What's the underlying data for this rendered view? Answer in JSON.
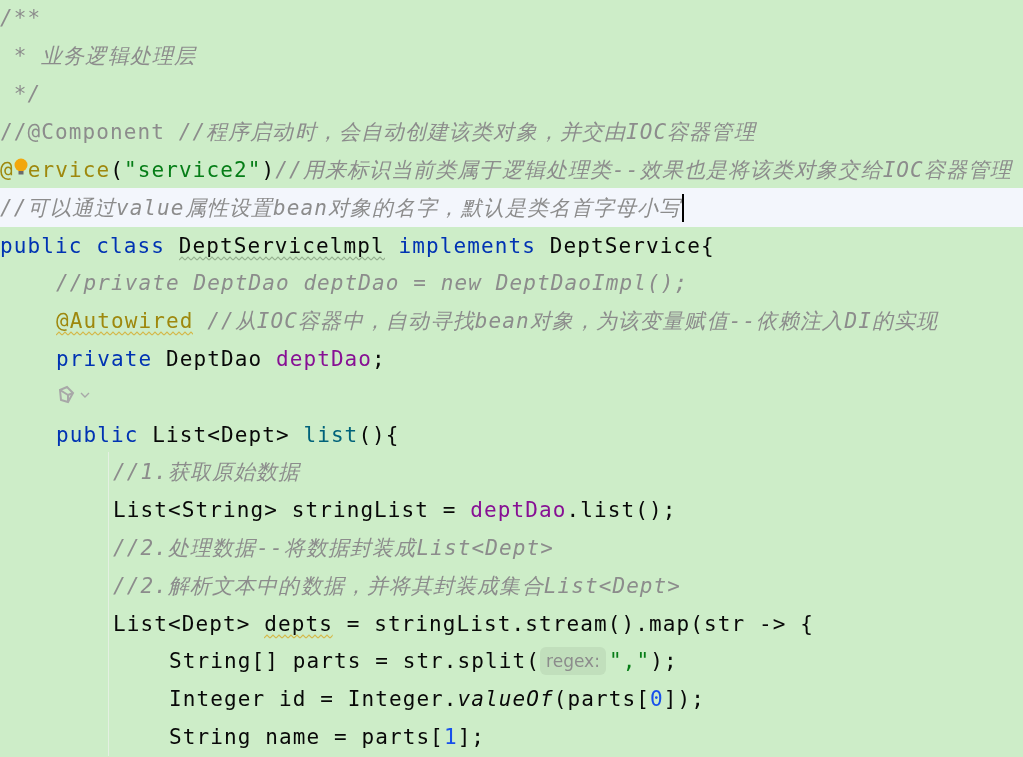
{
  "editor": {
    "lines": [
      {
        "kind": "code",
        "tokens": [
          {
            "text": "/**",
            "kind": "comment"
          }
        ]
      },
      {
        "kind": "code",
        "tokens": [
          {
            "text": " * 业务逻辑处理层",
            "kind": "comment"
          }
        ]
      },
      {
        "kind": "code",
        "tokens": [
          {
            "text": " */",
            "kind": "comment"
          }
        ]
      },
      {
        "kind": "code",
        "tokens": [
          {
            "text": "//@Component ",
            "kind": "commented-code"
          },
          {
            "text": "//程序启动时，会自动创建该类对象，并交由IOC容器管理",
            "kind": "comment"
          }
        ]
      },
      {
        "kind": "code",
        "tokens": [
          {
            "text": "@",
            "kind": "annotation"
          },
          {
            "kind": "bulb"
          },
          {
            "text": "ervice",
            "kind": "annotation"
          },
          {
            "text": "(",
            "kind": "plain"
          },
          {
            "text": "\"service2\"",
            "kind": "string"
          },
          {
            "text": ")",
            "kind": "plain"
          },
          {
            "text": "//用来标识当前类属于逻辑处理类--效果也是将该类对象交给IOC容器管理",
            "kind": "comment"
          }
        ]
      },
      {
        "kind": "code",
        "current": true,
        "tokens": [
          {
            "text": "//可以通过value属性设置bean对象的名字，默认是类名首字母小写",
            "kind": "comment"
          },
          {
            "kind": "caret"
          }
        ]
      },
      {
        "kind": "code",
        "tokens": [
          {
            "text": "public class ",
            "kind": "keyword"
          },
          {
            "text": "DeptServicelmpl",
            "kind": "plain",
            "misspelled": true
          },
          {
            "text": " implements ",
            "kind": "keyword"
          },
          {
            "text": "DeptService{",
            "kind": "plain"
          }
        ],
        "children": [
          {
            "kind": "code",
            "tokens": [
              {
                "text": "//private DeptDao deptDao = new DeptDaoImpl();",
                "kind": "comment"
              }
            ]
          },
          {
            "kind": "code",
            "tokens": [
              {
                "text": "@Autowired",
                "kind": "annotation",
                "warning": true
              },
              {
                "text": " //从IOC容器中，自动寻找bean对象，为该变量赋值--依赖注入DI的实现",
                "kind": "comment"
              }
            ]
          },
          {
            "kind": "code",
            "tokens": [
              {
                "text": "private ",
                "kind": "keyword"
              },
              {
                "text": "DeptDao ",
                "kind": "plain"
              },
              {
                "text": "deptDao",
                "kind": "field"
              },
              {
                "text": ";",
                "kind": "plain"
              }
            ]
          },
          {
            "kind": "ai-icon"
          },
          {
            "kind": "code",
            "tokens": [
              {
                "text": "public ",
                "kind": "keyword"
              },
              {
                "text": "List<Dept> ",
                "kind": "plain"
              },
              {
                "text": "list",
                "kind": "method"
              },
              {
                "text": "(){",
                "kind": "plain"
              }
            ],
            "children": [
              {
                "kind": "code",
                "tokens": [
                  {
                    "text": "//1.获取原始数据",
                    "kind": "comment"
                  }
                ]
              },
              {
                "kind": "code",
                "tokens": [
                  {
                    "text": "List<String> stringList = ",
                    "kind": "plain"
                  },
                  {
                    "text": "deptDao",
                    "kind": "field"
                  },
                  {
                    "text": ".list();",
                    "kind": "plain"
                  }
                ]
              },
              {
                "kind": "code",
                "tokens": [
                  {
                    "text": "//2.处理数据--将数据封装成List<Dept>",
                    "kind": "comment"
                  }
                ]
              },
              {
                "kind": "code",
                "tokens": [
                  {
                    "text": "//2.解析文本中的数据，并将其封装成集合List<Dept>",
                    "kind": "comment"
                  }
                ]
              },
              {
                "kind": "code",
                "tokens": [
                  {
                    "text": "List<Dept> ",
                    "kind": "plain"
                  },
                  {
                    "text": "depts",
                    "kind": "plain",
                    "warning": true
                  },
                  {
                    "text": " = stringList.stream().map(str -> {",
                    "kind": "plain"
                  }
                ],
                "children": [
                  {
                    "kind": "code",
                    "tokens": [
                      {
                        "text": "String[] parts = str.split(",
                        "kind": "plain"
                      },
                      {
                        "text": "regex:",
                        "kind": "hint"
                      },
                      {
                        "text": "\",\"",
                        "kind": "string"
                      },
                      {
                        "text": ");",
                        "kind": "plain"
                      }
                    ]
                  },
                  {
                    "kind": "code",
                    "tokens": [
                      {
                        "text": "Integer id = Integer.",
                        "kind": "plain"
                      },
                      {
                        "text": "valueOf",
                        "kind": "static-call"
                      },
                      {
                        "text": "(parts[",
                        "kind": "plain"
                      },
                      {
                        "text": "0",
                        "kind": "number"
                      },
                      {
                        "text": "]);",
                        "kind": "plain"
                      }
                    ]
                  },
                  {
                    "kind": "code",
                    "tokens": [
                      {
                        "text": "String name = parts[",
                        "kind": "plain"
                      },
                      {
                        "text": "1",
                        "kind": "number"
                      },
                      {
                        "text": "];",
                        "kind": "plain"
                      }
                    ]
                  }
                ]
              }
            ]
          }
        ]
      }
    ]
  }
}
